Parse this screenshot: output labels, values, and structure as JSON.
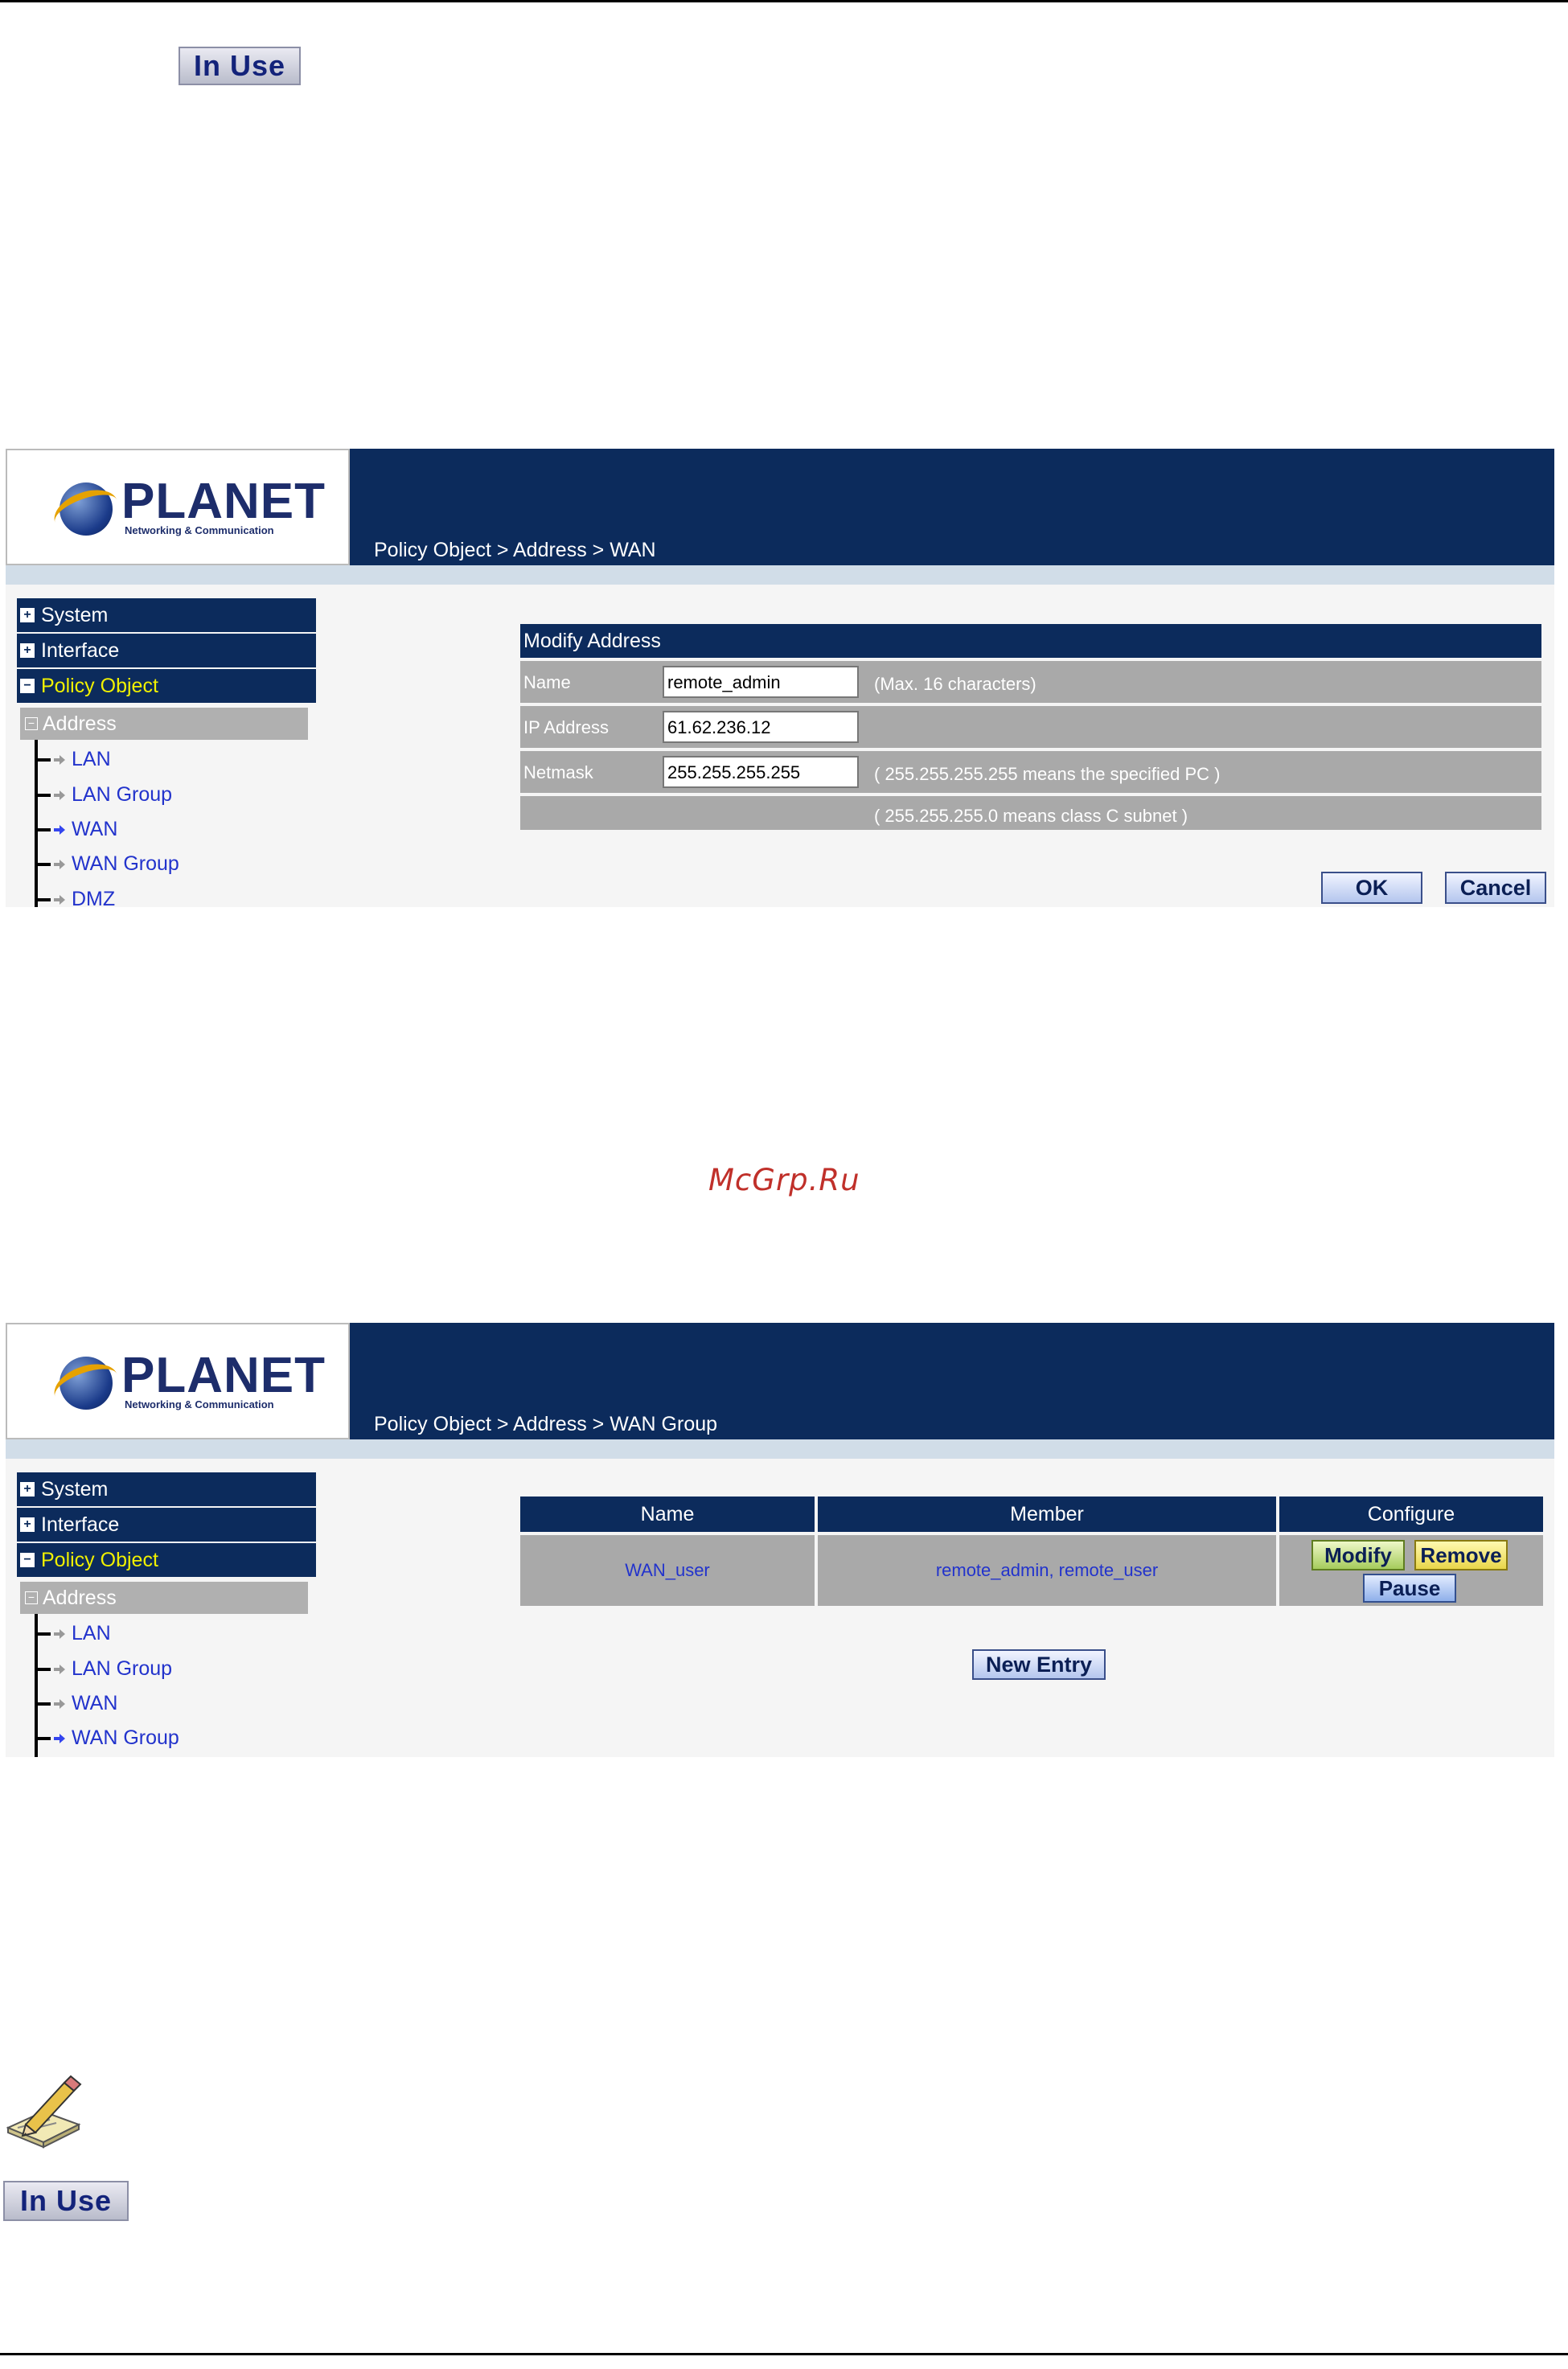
{
  "doc": {
    "in_use_label": "In Use",
    "watermark": "McGrp.Ru"
  },
  "shot1": {
    "logo_text": "PLANET",
    "logo_sub": "Networking & Communication",
    "breadcrumb": "Policy Object > Address > WAN",
    "menu": [
      "System",
      "Interface",
      "Policy Object"
    ],
    "address_label": "Address",
    "subitems": [
      "LAN",
      "LAN Group",
      "WAN",
      "WAN Group",
      "DMZ"
    ],
    "form_title": "Modify Address",
    "fields": [
      {
        "label": "Name",
        "value": "remote_admin",
        "hint": "(Max. 16 characters)"
      },
      {
        "label": "IP Address",
        "value": "61.62.236.12",
        "hint": ""
      },
      {
        "label": "Netmask",
        "value": "255.255.255.255",
        "hint": "( 255.255.255.255 means the specified PC )"
      }
    ],
    "extra_hint": "( 255.255.255.0 means class C subnet )",
    "ok": "OK",
    "cancel": "Cancel"
  },
  "shot2": {
    "logo_text": "PLANET",
    "logo_sub": "Networking & Communication",
    "breadcrumb": "Policy Object > Address > WAN Group",
    "menu": [
      "System",
      "Interface",
      "Policy Object"
    ],
    "address_label": "Address",
    "subitems": [
      "LAN",
      "LAN Group",
      "WAN",
      "WAN Group"
    ],
    "columns": [
      "Name",
      "Member",
      "Configure"
    ],
    "row": {
      "name": "WAN_user",
      "member": "remote_admin, remote_user"
    },
    "modify": "Modify",
    "remove": "Remove",
    "pause": "Pause",
    "new_entry": "New Entry"
  }
}
